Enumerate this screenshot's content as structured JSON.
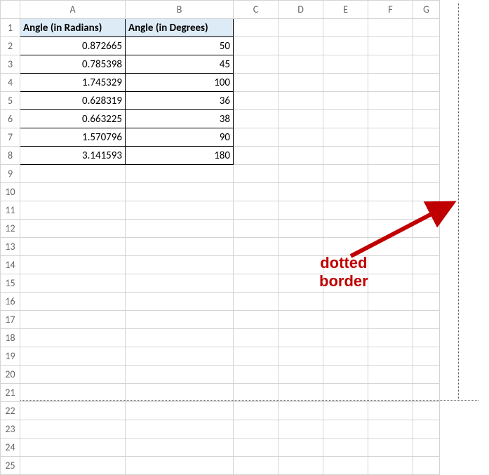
{
  "columns": [
    "A",
    "B",
    "C",
    "D",
    "E",
    "F",
    "G"
  ],
  "row_count": 25,
  "headers": {
    "A": "Angle (in Radians)",
    "B": "Angle (in Degrees)"
  },
  "rows": [
    {
      "A": "0.872665",
      "B": "50"
    },
    {
      "A": "0.785398",
      "B": "45"
    },
    {
      "A": "1.745329",
      "B": "100"
    },
    {
      "A": "0.628319",
      "B": "36"
    },
    {
      "A": "0.663225",
      "B": "38"
    },
    {
      "A": "1.570796",
      "B": "90"
    },
    {
      "A": "3.141593",
      "B": "180"
    }
  ],
  "annotation": {
    "line1": "dotted",
    "line2": "border"
  },
  "chart_data": {
    "type": "table",
    "title": "",
    "columns": [
      "Angle (in Radians)",
      "Angle (in Degrees)"
    ],
    "data": [
      [
        0.872665,
        50
      ],
      [
        0.785398,
        45
      ],
      [
        1.745329,
        100
      ],
      [
        0.628319,
        36
      ],
      [
        0.663225,
        38
      ],
      [
        1.570796,
        90
      ],
      [
        3.141593,
        180
      ]
    ]
  }
}
